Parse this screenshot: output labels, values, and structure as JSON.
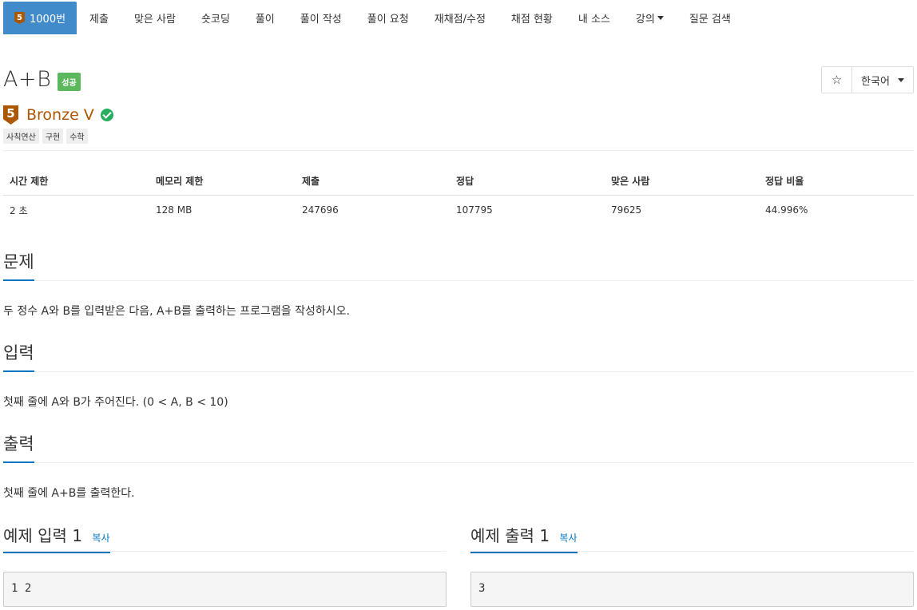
{
  "nav": {
    "active_badge": "5",
    "items": [
      "1000번",
      "제출",
      "맞은 사람",
      "숏코딩",
      "풀이",
      "풀이 작성",
      "풀이 요청",
      "재채점/수정",
      "채점 현황",
      "내 소스",
      "강의",
      "질문 검색"
    ]
  },
  "problem": {
    "title": "A+B",
    "result_label": "성공",
    "tier_number": "5",
    "tier_name": "Bronze V",
    "tags": [
      "사칙연산",
      "구현",
      "수학"
    ],
    "language": "한국어",
    "star": "☆"
  },
  "stats": {
    "headers": [
      "시간 제한",
      "메모리 제한",
      "제출",
      "정답",
      "맞은 사람",
      "정답 비율"
    ],
    "values": [
      "2 초",
      "128 MB",
      "247696",
      "107795",
      "79625",
      "44.996%"
    ]
  },
  "sections": {
    "problem_title": "문제",
    "problem_text": "두 정수 A와 B를 입력받은 다음, A+B를 출력하는 프로그램을 작성하시오.",
    "input_title": "입력",
    "input_text": "첫째 줄에 A와 B가 주어진다. (0 < A, B < 10)",
    "output_title": "출력",
    "output_text": "첫째 줄에 A+B를 출력한다."
  },
  "samples": {
    "input_title": "예제 입력 1",
    "output_title": "예제 출력 1",
    "copy_label": "복사",
    "input_value": "1 2",
    "output_value": "3"
  },
  "colors": {
    "nav_active": "#428bca",
    "bronze": "#ad5600",
    "success": "#5cb85c",
    "accent_underline": "#0076c0"
  }
}
